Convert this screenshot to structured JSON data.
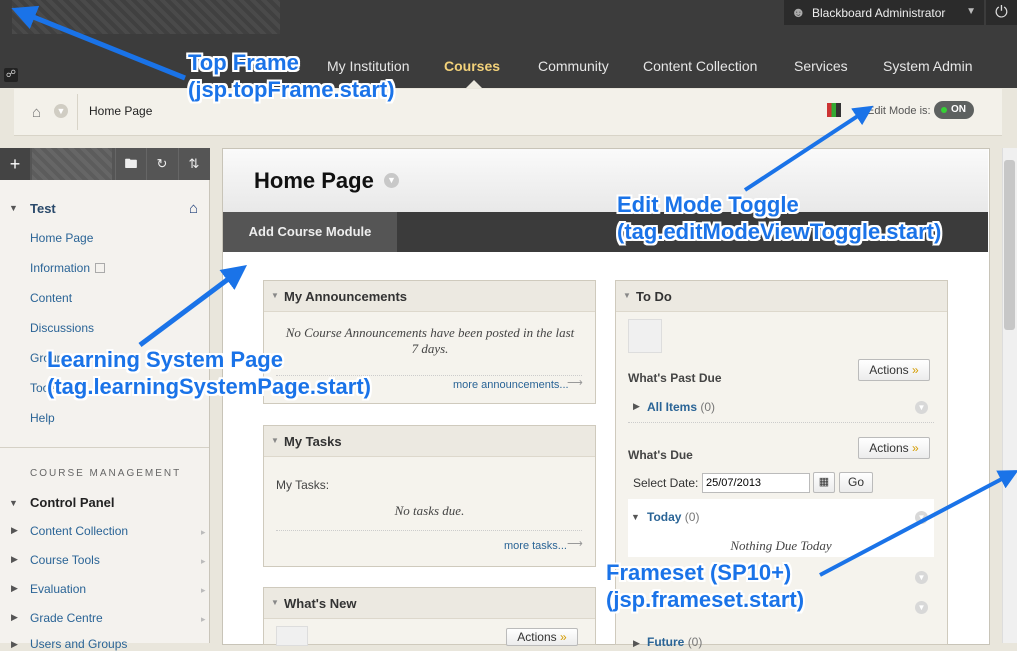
{
  "top": {
    "user_name": "Blackboard Administrator",
    "nav": [
      "My Institution",
      "Courses",
      "Community",
      "Content Collection",
      "Services",
      "System Admin"
    ],
    "active_nav": "Courses"
  },
  "breadcrumb": {
    "current": "Home Page",
    "edit_mode_label": "Edit Mode is:",
    "edit_mode_value": "ON"
  },
  "menu": {
    "course_name": "Test",
    "items": [
      "Home Page",
      "Information",
      "Content",
      "Discussions",
      "Groups",
      "Tools",
      "Help"
    ],
    "course_management_title": "COURSE MANAGEMENT",
    "control_panel": "Control Panel",
    "control_items": [
      "Content Collection",
      "Course Tools",
      "Evaluation",
      "Grade Centre",
      "Users and Groups"
    ]
  },
  "page": {
    "title": "Home Page",
    "add_module": "Add Course Module"
  },
  "announcements": {
    "title": "My Announcements",
    "empty": "No Course Announcements have been posted in the last 7 days.",
    "more": "more announcements..."
  },
  "tasks": {
    "title": "My Tasks",
    "label": "My Tasks:",
    "empty": "No tasks due.",
    "more": "more tasks..."
  },
  "whats_new": {
    "title": "What's New",
    "actions": "Actions"
  },
  "todo": {
    "title": "To Do",
    "past_due_title": "What's Past Due",
    "actions": "Actions",
    "all_items_label": "All Items",
    "all_items_count": "(0)",
    "due_title": "What's Due",
    "select_date_label": "Select Date:",
    "select_date_value": "25/07/2013",
    "go": "Go",
    "today_label": "Today",
    "today_count": "(0)",
    "today_empty": "Nothing Due Today",
    "future_label": "Future",
    "future_count": "(0)"
  },
  "annotations": {
    "top_frame_title": "Top Frame",
    "top_frame_sub": "(jsp.topFrame.start)",
    "edit_toggle_title": "Edit Mode Toggle",
    "edit_toggle_sub": "(tag.editModeViewToggle.start)",
    "lsp_title": "Learning System Page",
    "lsp_sub": "(tag.learningSystemPage.start)",
    "frameset_title": "Frameset (SP10+)",
    "frameset_sub": "(jsp.frameset.start)"
  },
  "colors": {
    "annotation": "#1a73e8",
    "top_bar": "#3c3c3c",
    "active_nav": "#f3d27a",
    "link": "#2a6496"
  },
  "icons": [
    "user-icon",
    "power-icon",
    "home-icon",
    "link-icon",
    "plus-icon",
    "folder-icon",
    "refresh-icon",
    "sort-icon",
    "calendar-icon"
  ]
}
